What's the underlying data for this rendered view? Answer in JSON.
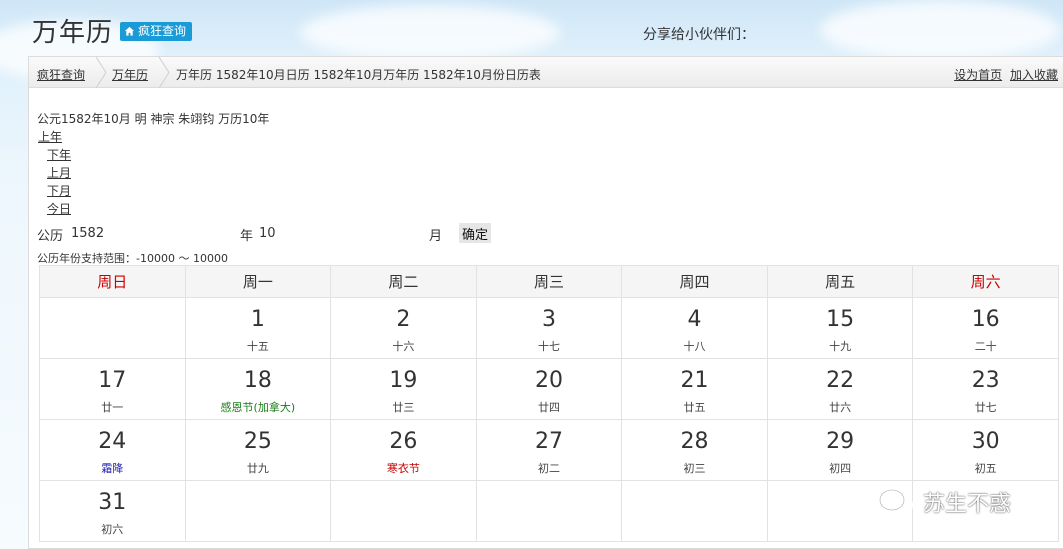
{
  "header": {
    "title": "万年历",
    "site_badge": "疯狂查询",
    "share_label": "分享给小伙伴们："
  },
  "breadcrumb": {
    "home": "疯狂查询",
    "section": "万年历",
    "current": "万年历 1582年10月日历 1582年10月万年历 1582年10月份日历表",
    "set_home": "设为首页",
    "add_bookmark": "加入收藏"
  },
  "info": {
    "era_line": "公元1582年10月 明 神宗 朱翊钧 万历10年"
  },
  "nav": {
    "prev_year": "上年",
    "next_year": "下年",
    "prev_month": "上月",
    "next_month": "下月",
    "today": "今日"
  },
  "form": {
    "calendar_label": "公历",
    "year_value": "1582",
    "year_unit": "年",
    "month_value": "10",
    "month_unit": "月",
    "confirm": "确定",
    "range_note": "公历年份支持范围：-10000 ～ 10000"
  },
  "calendar": {
    "weekdays": [
      "周日",
      "周一",
      "周二",
      "周三",
      "周四",
      "周五",
      "周六"
    ],
    "weeks": [
      [
        {
          "day": "",
          "lunar": "",
          "type": ""
        },
        {
          "day": "1",
          "lunar": "十五",
          "type": ""
        },
        {
          "day": "2",
          "lunar": "十六",
          "type": ""
        },
        {
          "day": "3",
          "lunar": "十七",
          "type": ""
        },
        {
          "day": "4",
          "lunar": "十八",
          "type": ""
        },
        {
          "day": "15",
          "lunar": "十九",
          "type": ""
        },
        {
          "day": "16",
          "lunar": "二十",
          "type": ""
        }
      ],
      [
        {
          "day": "17",
          "lunar": "廿一",
          "type": ""
        },
        {
          "day": "18",
          "lunar": "感恩节(加拿大)",
          "type": "holiday"
        },
        {
          "day": "19",
          "lunar": "廿三",
          "type": ""
        },
        {
          "day": "20",
          "lunar": "廿四",
          "type": ""
        },
        {
          "day": "21",
          "lunar": "廿五",
          "type": ""
        },
        {
          "day": "22",
          "lunar": "廿六",
          "type": ""
        },
        {
          "day": "23",
          "lunar": "廿七",
          "type": ""
        }
      ],
      [
        {
          "day": "24",
          "lunar": "霜降",
          "type": "solar-term"
        },
        {
          "day": "25",
          "lunar": "廿九",
          "type": ""
        },
        {
          "day": "26",
          "lunar": "寒衣节",
          "type": "festival"
        },
        {
          "day": "27",
          "lunar": "初二",
          "type": ""
        },
        {
          "day": "28",
          "lunar": "初三",
          "type": ""
        },
        {
          "day": "29",
          "lunar": "初四",
          "type": ""
        },
        {
          "day": "30",
          "lunar": "初五",
          "type": ""
        }
      ],
      [
        {
          "day": "31",
          "lunar": "初六",
          "type": ""
        },
        {
          "day": "",
          "lunar": "",
          "type": ""
        },
        {
          "day": "",
          "lunar": "",
          "type": ""
        },
        {
          "day": "",
          "lunar": "",
          "type": ""
        },
        {
          "day": "",
          "lunar": "",
          "type": ""
        },
        {
          "day": "",
          "lunar": "",
          "type": ""
        },
        {
          "day": "",
          "lunar": "",
          "type": ""
        }
      ]
    ]
  },
  "watermark": {
    "text": "苏生不惑",
    "icon": "wechat-icon"
  },
  "colors": {
    "accent_blue": "#1a9bd8",
    "weekend_red": "#cc0000",
    "holiday_green": "#1a7f1a",
    "solar_term_blue": "#1a1aaa"
  }
}
